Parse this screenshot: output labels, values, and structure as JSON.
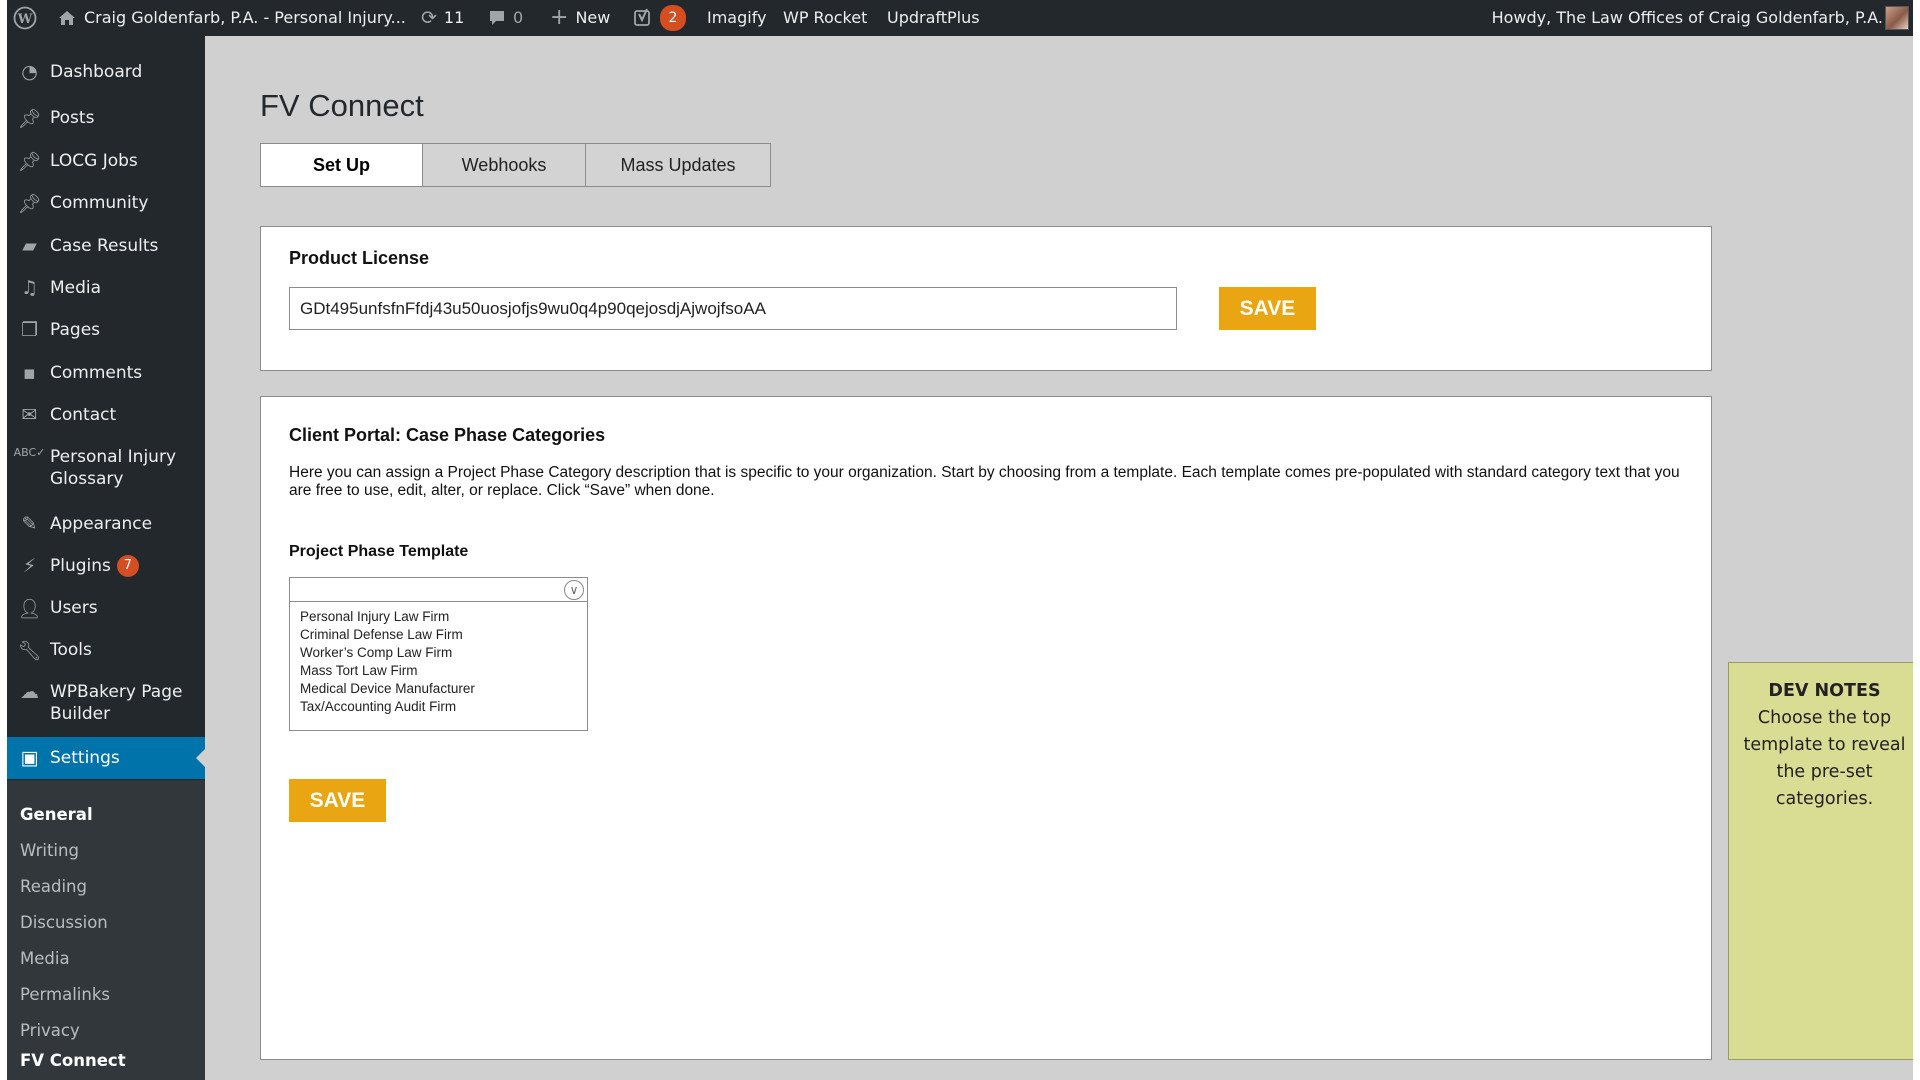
{
  "adminbar": {
    "site_name": "Craig Goldenfarb, P.A. - Personal Injury...",
    "updates_count": "11",
    "comments_count": "0",
    "new_label": "New",
    "yoast_count": "2",
    "imagify": "Imagify",
    "wp_rocket": "WP Rocket",
    "updraft": "UpdraftPlus",
    "howdy": "Howdy, The Law Offices of Craig Goldenfarb, P.A."
  },
  "sidebar": {
    "items": [
      {
        "label": "Dashboard",
        "icon": "dashboard-icon"
      },
      {
        "label": "Posts",
        "icon": "pin-icon"
      },
      {
        "label": "LOCG Jobs",
        "icon": "pin-icon"
      },
      {
        "label": "Community",
        "icon": "pin-icon"
      },
      {
        "label": "Case Results",
        "icon": "folder-icon"
      },
      {
        "label": "Media",
        "icon": "media-icon"
      },
      {
        "label": "Pages",
        "icon": "pages-icon"
      },
      {
        "label": "Comments",
        "icon": "comment-icon"
      },
      {
        "label": "Contact",
        "icon": "mail-icon"
      },
      {
        "label": "Personal Injury Glossary",
        "icon": "abc-icon"
      },
      {
        "label": "Appearance",
        "icon": "brush-icon"
      },
      {
        "label": "Plugins",
        "icon": "plug-icon",
        "badge": "7"
      },
      {
        "label": "Users",
        "icon": "user-icon"
      },
      {
        "label": "Tools",
        "icon": "wrench-icon"
      },
      {
        "label": "WPBakery Page Builder",
        "icon": "cloud-icon"
      },
      {
        "label": "Settings",
        "icon": "settings-icon"
      }
    ],
    "submenu": [
      "General",
      "Writing",
      "Reading",
      "Discussion",
      "Media",
      "Permalinks",
      "Privacy",
      "FV Connect"
    ]
  },
  "page": {
    "title": "FV Connect",
    "tabs": [
      "Set Up",
      "Webhooks",
      "Mass Updates"
    ]
  },
  "license": {
    "title": "Product License",
    "value": "GDt495unfsfnFfdj43u50uosjofjs9wu0q4p90qejosdjAjwojfsoAA",
    "save_label": "SAVE"
  },
  "portal": {
    "title": "Client Portal: Case Phase Categories",
    "description": "Here you can assign a Project Phase Category description that is specific to your organization. Start by choosing from a template. Each template comes pre-populated with standard category text that you are free to use, edit, alter, or replace. Click “Save” when done.",
    "template_label": "Project Phase Template",
    "options": [
      "Personal Injury Law Firm",
      "Criminal Defense Law Firm",
      "Worker’s Comp Law Firm",
      "Mass Tort Law Firm",
      "Medical Device Manufacturer",
      "Tax/Accounting Audit Firm"
    ],
    "save_label": "SAVE"
  },
  "dev_notes": {
    "title": "DEV NOTES",
    "body": "Choose the top template to reveal the pre-set categories."
  },
  "colors": {
    "admin_dark": "#23282d",
    "submenu_bg": "#32373c",
    "accent_blue": "#0073aa",
    "save_orange": "#e9a512",
    "badge_red": "#d54e21",
    "note_yellow": "#d9dc93"
  }
}
